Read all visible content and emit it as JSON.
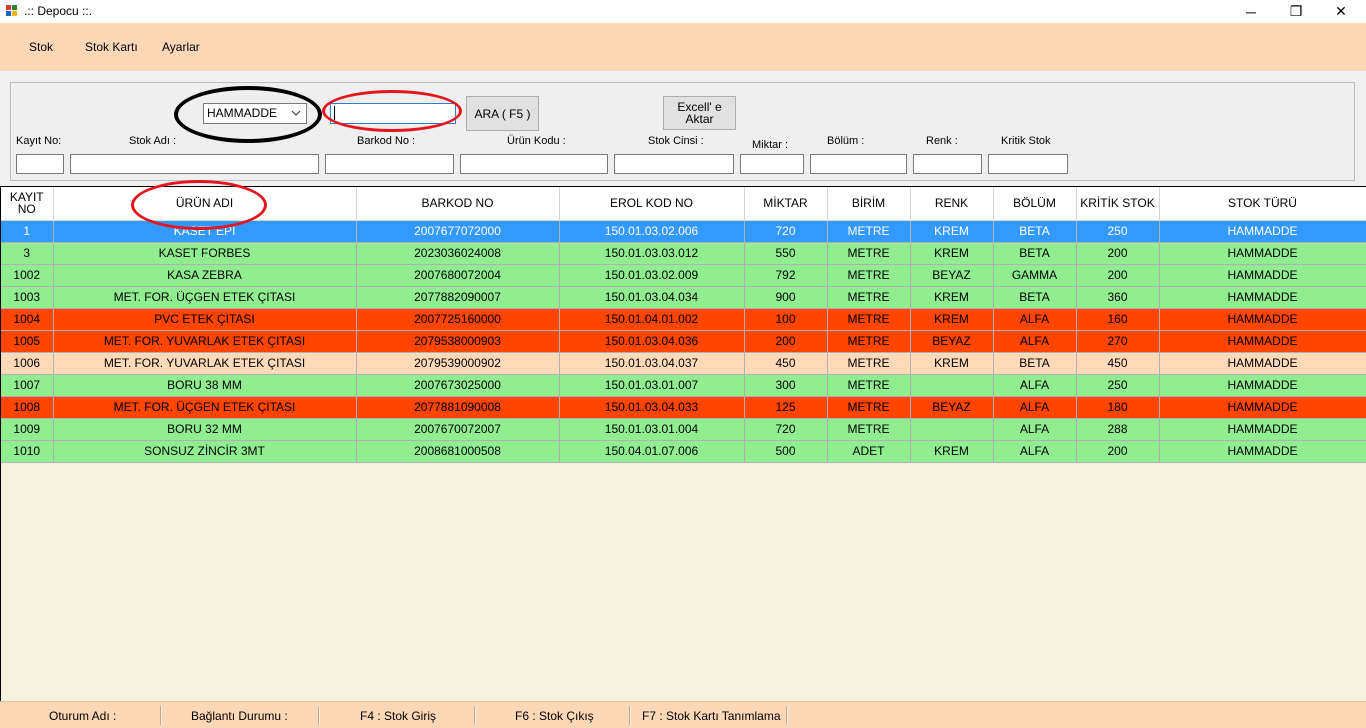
{
  "window": {
    "title": ".:: Depocu ::.",
    "minimize_glyph": "─",
    "restore_glyph": "❐",
    "close_glyph": "✕"
  },
  "menu": {
    "items": [
      "Stok",
      "Stok Kartı",
      "Ayarlar"
    ]
  },
  "filter": {
    "category_value": "HAMMADDE",
    "search_value": "",
    "search_button_label": "ARA ( F5 )",
    "excel_button_line1": "Excell' e",
    "excel_button_line2": "Aktar",
    "labels": {
      "kayit_no": "Kayıt No:",
      "stok_adi": "Stok Adı :",
      "barkod_no": "Barkod No :",
      "urun_kodu": "Ürün Kodu :",
      "stok_cinsi": "Stok Cinsi :",
      "miktar": "Miktar :",
      "bolum": "Bölüm :",
      "renk": "Renk :",
      "kritik_stok": "Kritik Stok"
    }
  },
  "grid": {
    "headers": {
      "kayit_no": "KAYIT NO",
      "urun_adi": "ÜRÜN ADI",
      "barkod_no": "BARKOD NO",
      "erol_kod_no": "EROL KOD NO",
      "miktar": "MİKTAR",
      "birim": "BİRİM",
      "renk": "RENK",
      "bolum": "BÖLÜM",
      "kritik_stok": "KRİTİK STOK",
      "stok_turu": "STOK TÜRÜ"
    },
    "rows": [
      {
        "kayit_no": "1",
        "urun_adi": "KASET EPI",
        "barkod_no": "2007677072000",
        "erol_kod_no": "150.01.03.02.006",
        "miktar": "720",
        "birim": "METRE",
        "renk": "KREM",
        "bolum": "BETA",
        "kritik_stok": "250",
        "stok_turu": "HAMMADDE",
        "status": "selected"
      },
      {
        "kayit_no": "3",
        "urun_adi": "KASET FORBES",
        "barkod_no": "2023036024008",
        "erol_kod_no": "150.01.03.03.012",
        "miktar": "550",
        "birim": "METRE",
        "renk": "KREM",
        "bolum": "BETA",
        "kritik_stok": "200",
        "stok_turu": "HAMMADDE",
        "status": "green"
      },
      {
        "kayit_no": "1002",
        "urun_adi": "KASA ZEBRA",
        "barkod_no": "2007680072004",
        "erol_kod_no": "150.01.03.02.009",
        "miktar": "792",
        "birim": "METRE",
        "renk": "BEYAZ",
        "bolum": "GAMMA",
        "kritik_stok": "200",
        "stok_turu": "HAMMADDE",
        "status": "green"
      },
      {
        "kayit_no": "1003",
        "urun_adi": "MET. FOR. ÜÇGEN ETEK ÇITASI",
        "barkod_no": "2077882090007",
        "erol_kod_no": "150.01.03.04.034",
        "miktar": "900",
        "birim": "METRE",
        "renk": "KREM",
        "bolum": "BETA",
        "kritik_stok": "360",
        "stok_turu": "HAMMADDE",
        "status": "green"
      },
      {
        "kayit_no": "1004",
        "urun_adi": "PVC ETEK ÇITASI",
        "barkod_no": "2007725160000",
        "erol_kod_no": "150.01.04.01.002",
        "miktar": "100",
        "birim": "METRE",
        "renk": "KREM",
        "bolum": "ALFA",
        "kritik_stok": "160",
        "stok_turu": "HAMMADDE",
        "status": "red"
      },
      {
        "kayit_no": "1005",
        "urun_adi": "MET. FOR. YUVARLAK ETEK ÇITASI",
        "barkod_no": "2079538000903",
        "erol_kod_no": "150.01.03.04.036",
        "miktar": "200",
        "birim": "METRE",
        "renk": "BEYAZ",
        "bolum": "ALFA",
        "kritik_stok": "270",
        "stok_turu": "HAMMADDE",
        "status": "red"
      },
      {
        "kayit_no": "1006",
        "urun_adi": "MET. FOR. YUVARLAK ETEK ÇITASI",
        "barkod_no": "2079539000902",
        "erol_kod_no": "150.01.03.04.037",
        "miktar": "450",
        "birim": "METRE",
        "renk": "KREM",
        "bolum": "BETA",
        "kritik_stok": "450",
        "stok_turu": "HAMMADDE",
        "status": "peach"
      },
      {
        "kayit_no": "1007",
        "urun_adi": "BORU 38 MM",
        "barkod_no": "2007673025000",
        "erol_kod_no": "150.01.03.01.007",
        "miktar": "300",
        "birim": "METRE",
        "renk": "",
        "bolum": "ALFA",
        "kritik_stok": "250",
        "stok_turu": "HAMMADDE",
        "status": "green"
      },
      {
        "kayit_no": "1008",
        "urun_adi": "MET. FOR. ÜÇGEN ETEK ÇITASI",
        "barkod_no": "2077881090008",
        "erol_kod_no": "150.01.03.04.033",
        "miktar": "125",
        "birim": "METRE",
        "renk": "BEYAZ",
        "bolum": "ALFA",
        "kritik_stok": "180",
        "stok_turu": "HAMMADDE",
        "status": "red"
      },
      {
        "kayit_no": "1009",
        "urun_adi": "BORU 32 MM",
        "barkod_no": "2007670072007",
        "erol_kod_no": "150.01.03.01.004",
        "miktar": "720",
        "birim": "METRE",
        "renk": "",
        "bolum": "ALFA",
        "kritik_stok": "288",
        "stok_turu": "HAMMADDE",
        "status": "green"
      },
      {
        "kayit_no": "1010",
        "urun_adi": "SONSUZ ZİNCİR 3MT",
        "barkod_no": "2008681000508",
        "erol_kod_no": "150.04.01.07.006",
        "miktar": "500",
        "birim": "ADET",
        "renk": "KREM",
        "bolum": "ALFA",
        "kritik_stok": "200",
        "stok_turu": "HAMMADDE",
        "status": "green"
      }
    ]
  },
  "statusbar": {
    "oturum": "Oturum Adı :",
    "baglanti": "Bağlantı Durumu :",
    "f4": "F4 : Stok Giriş",
    "f6": "F6 : Stok Çıkış",
    "f7": "F7 : Stok Kartı Tanımlama"
  },
  "colors": {
    "menu_bg": "#fdd8b7",
    "row_ok": "#90ee90",
    "row_critical": "#ff4500",
    "row_warning": "#ffdab9",
    "row_selected": "#3399ff",
    "grid_bg": "#f5f3de",
    "annotation_red": "#e3161e",
    "annotation_black": "#000000"
  },
  "icons": [
    "app-icon",
    "chevron-down-icon",
    "minimize-icon",
    "restore-icon",
    "close-icon"
  ]
}
